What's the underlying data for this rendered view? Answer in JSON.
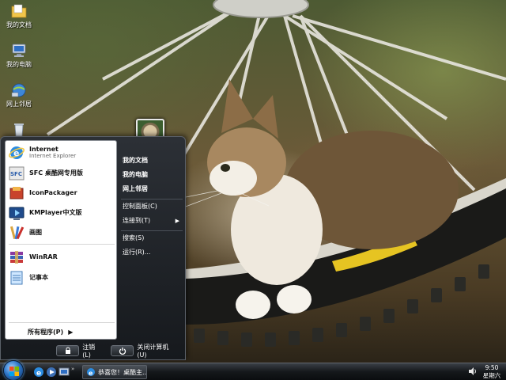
{
  "desktop": {
    "icons": [
      {
        "label": "我的文档",
        "icon": "folder-documents-icon"
      },
      {
        "label": "我的电脑",
        "icon": "computer-icon"
      },
      {
        "label": "网上邻居",
        "icon": "network-icon"
      },
      {
        "label": "",
        "icon": "recycle-bin-icon"
      }
    ]
  },
  "start_menu": {
    "pinned": [
      {
        "name": "Internet",
        "sub": "Internet Explorer",
        "icon": "internet-explorer-icon"
      },
      {
        "name": "SFC 桌酷网专用版",
        "sub": "",
        "icon": "sfc-icon"
      },
      {
        "name": "IconPackager",
        "sub": "",
        "icon": "iconpackager-icon"
      },
      {
        "name": "KMPlayer中文版",
        "sub": "",
        "icon": "kmplayer-icon"
      },
      {
        "name": "画图",
        "sub": "",
        "icon": "paint-icon"
      },
      {
        "name": "WinRAR",
        "sub": "",
        "icon": "winrar-icon"
      },
      {
        "name": "记事本",
        "sub": "",
        "icon": "notepad-icon"
      }
    ],
    "all_programs": "所有程序(P)",
    "right": {
      "my_documents": "我的文档",
      "my_computer": "我的电脑",
      "network": "网上邻居",
      "control_panel": "控制面板(C)",
      "connect_to": "连接到(T)",
      "search": "搜索(S)",
      "run": "运行(R)..."
    },
    "logoff": "注销(L)",
    "shutdown": "关闭计算机(U)"
  },
  "taskbar": {
    "task_label": "恭喜您！桌酷主...",
    "clock_time": "9:50",
    "clock_day": "星期六"
  },
  "colors": {
    "start_menu_bg": "#16191d",
    "taskbar_bg": "#15181b",
    "accent_blue": "#2f77c8"
  }
}
